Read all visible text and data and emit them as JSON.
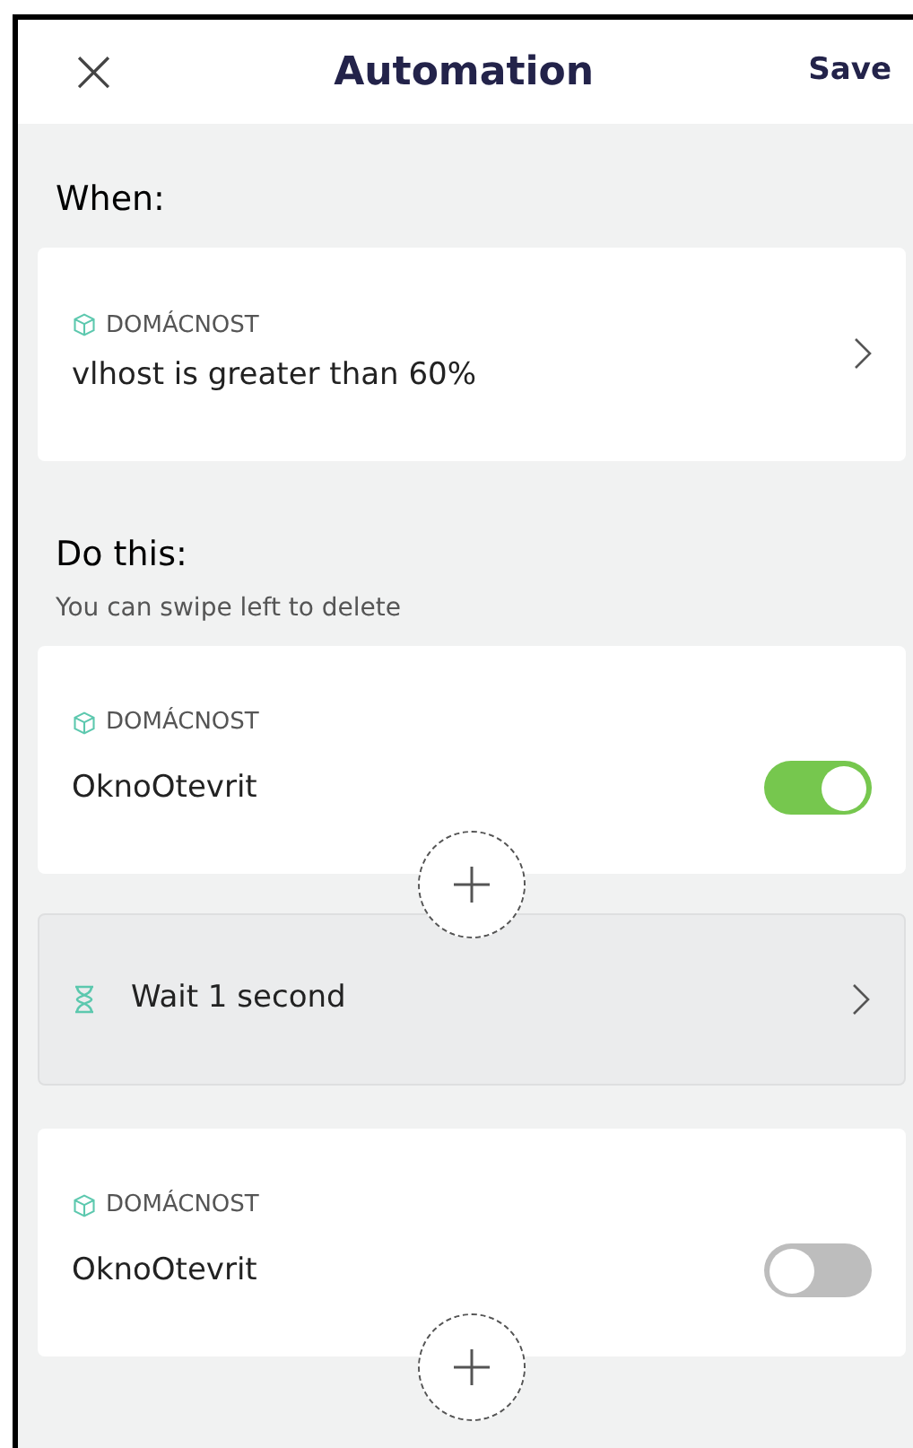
{
  "header": {
    "close": "×",
    "title": "Automation",
    "save": "Save"
  },
  "when": {
    "heading": "When:",
    "card": {
      "category": "DOMÁCNOST",
      "text": "vlhost is greater than 60%"
    }
  },
  "do_this": {
    "heading": "Do this:",
    "hint": "You can swipe left to delete",
    "actions": [
      {
        "kind": "device",
        "category": "DOMÁCNOST",
        "name": "OknoOtevrit",
        "on": true
      },
      {
        "kind": "wait",
        "text": "Wait 1 second"
      },
      {
        "kind": "device",
        "category": "DOMÁCNOST",
        "name": "OknoOtevrit",
        "on": false
      }
    ]
  }
}
